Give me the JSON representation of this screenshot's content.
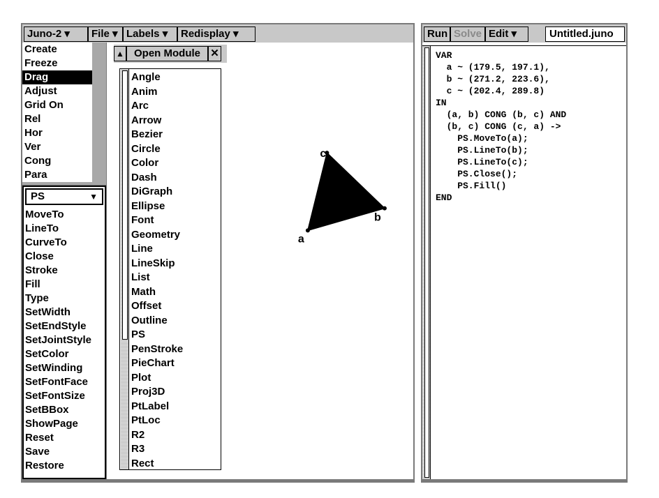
{
  "menubar": {
    "items": [
      {
        "label": "Juno-2",
        "arrow": "▾"
      },
      {
        "label": "File",
        "arrow": "▾"
      },
      {
        "label": "Labels",
        "arrow": "▾"
      },
      {
        "label": "Redisplay",
        "arrow": "▾"
      }
    ]
  },
  "tools": [
    "Create",
    "Freeze",
    "Drag",
    "Adjust",
    "Grid On",
    "Rel",
    "Hor",
    "Ver",
    "Cong",
    "Para"
  ],
  "selected_tool": "Drag",
  "ps_panel": {
    "module": "PS",
    "arrow": "▼",
    "items": [
      "MoveTo",
      "LineTo",
      "CurveTo",
      "Close",
      "Stroke",
      "Fill",
      "Type",
      "SetWidth",
      "SetEndStyle",
      "SetJointStyle",
      "SetColor",
      "SetWinding",
      "SetFontFace",
      "SetFontSize",
      "SetBBox",
      "ShowPage",
      "Reset",
      "Save",
      "Restore"
    ]
  },
  "open_module": {
    "up_arrow": "▲",
    "title": "Open Module",
    "close": "✕",
    "modules": [
      "Angle",
      "Anim",
      "Arc",
      "Arrow",
      "Bezier",
      "Circle",
      "Color",
      "Dash",
      "DiGraph",
      "Ellipse",
      "Font",
      "Geometry",
      "Line",
      "LineSkip",
      "List",
      "Math",
      "Offset",
      "Outline",
      "PS",
      "PenStroke",
      "PieChart",
      "Plot",
      "Proj3D",
      "PtLabel",
      "PtLoc",
      "R2",
      "R3",
      "Rect"
    ]
  },
  "drawing": {
    "points": [
      {
        "label": "a",
        "x": 179.5,
        "y": 197.1
      },
      {
        "label": "b",
        "x": 271.2,
        "y": 223.6
      },
      {
        "label": "c",
        "x": 202.4,
        "y": 289.8
      }
    ],
    "fill_color": "#000000"
  },
  "editor_toolbar": {
    "run": "Run",
    "solve": "Solve",
    "edit": "Edit",
    "edit_arrow": "▾",
    "filename": "Untitled.juno"
  },
  "code": [
    "VAR",
    "  a ~ (179.5, 197.1),",
    "  b ~ (271.2, 223.6),",
    "  c ~ (202.4, 289.8)",
    "IN",
    "  (a, b) CONG (b, c) AND",
    "  (b, c) CONG (c, a) ->",
    "    PS.MoveTo(a);",
    "    PS.LineTo(b);",
    "    PS.LineTo(c);",
    "    PS.Close();",
    "    PS.Fill()",
    "END"
  ],
  "colors": {
    "frame": "#7a7a7a",
    "menubar": "#c8c8c8",
    "disabled_text": "#8a8a8a",
    "selected_bg": "#000000"
  }
}
